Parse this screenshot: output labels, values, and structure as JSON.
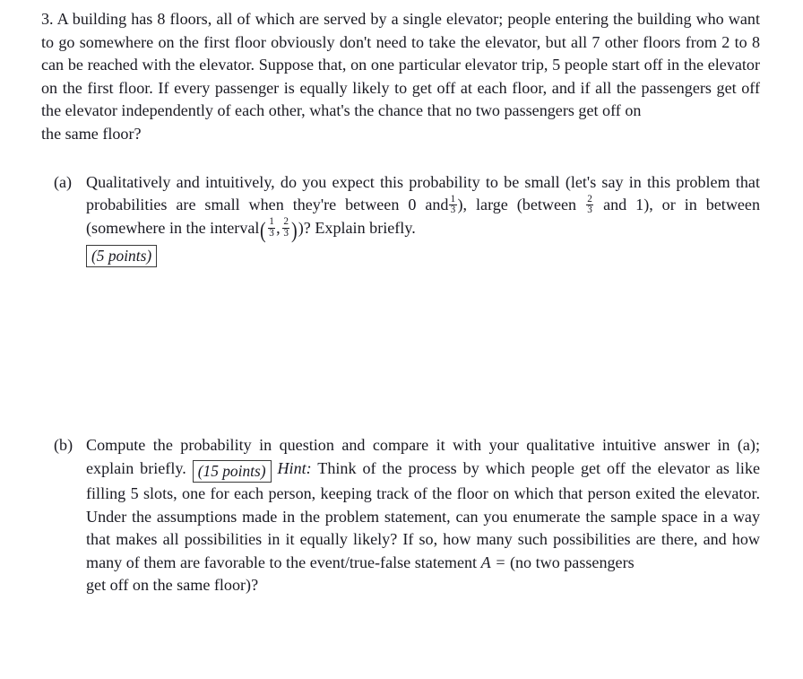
{
  "document": {
    "type": "homework-problem",
    "background_color": "#ffffff",
    "text_color": "#1a1a22",
    "box_border_color": "#3a3a3a"
  },
  "problem": {
    "number": "3.",
    "text_before_first_fraction": "A building has 8 floors, all of which are served by a single elevator; people entering the building who want to go somewhere on the first floor obviously don't need to take the elevator, but all 7 other floors from 2 to 8 can be reached with the elevator. Suppose that, on one particular elevator trip, 5 people start off in the elevator on the first floor. If every passenger is equally likely to get off at each floor, and if all the passengers get off the elevator independently of each other, what's the chance that no two passengers get off on",
    "last_line": "the same floor?"
  },
  "parts": [
    {
      "label": "(a)",
      "segment_1": "Qualitatively and intuitively, do you expect this probability to be small (let's say in this problem that probabilities are small when they're between 0 and",
      "frac_1": {
        "num": "1",
        "den": "3"
      },
      "segment_2": "), large (between",
      "frac_2": {
        "num": "2",
        "den": "3"
      },
      "segment_3": "and 1), or in between (somewhere in the interval",
      "frac_3": {
        "num": "1",
        "den": "3"
      },
      "frac_4": {
        "num": "2",
        "den": "3"
      },
      "segment_4": ")? Explain briefly.",
      "points_label": "(5 points)",
      "points_inline": false
    },
    {
      "label": "(b)",
      "segment_1": "Compute the probability in question and compare it with your qualitative intuitive answer in (a); explain briefly.",
      "points_label": "(15 points)",
      "points_inline": true,
      "hint_label": "Hint:",
      "segment_2": "Think of the process by which people get off the elevator as like filling 5 slots, one for each person, keeping track of the floor on which that person exited the elevator. Under the assumptions made in the problem statement, can you enumerate the sample space in a way that makes all possibilities in it equally likely? If so, how many such possibilities are there, and how many of them are favorable to the event/true-false statement",
      "math_var": "A",
      "math_equals": "=",
      "segment_3": "(no two passengers",
      "last_line": "get off on the same floor)?"
    }
  ]
}
